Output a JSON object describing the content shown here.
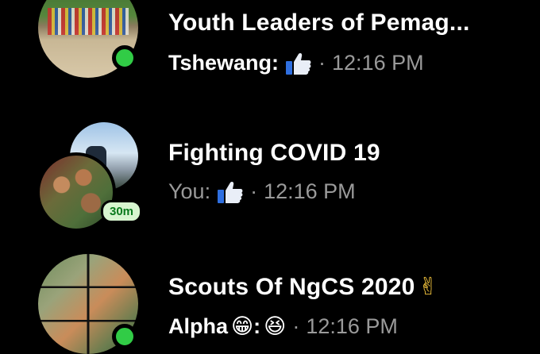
{
  "conversations": [
    {
      "title": "Youth Leaders of Pemag...",
      "sender": "Tshewang:",
      "message_icon": "thumbs-up-icon",
      "separator": "·",
      "time": "12:16 PM",
      "online": true,
      "unread": true
    },
    {
      "title": "Fighting COVID 19",
      "sender": "You:",
      "message_icon": "thumbs-up-icon",
      "separator": "·",
      "time": "12:16 PM",
      "active_badge": "30m",
      "unread": false
    },
    {
      "title": "Scouts Of NgCS 2020",
      "title_emoji": "✌",
      "sender": "Alpha",
      "message_emojis": [
        "😁",
        ":",
        "😆"
      ],
      "separator": "·",
      "time": "12:16 PM",
      "online": true,
      "unread": true
    }
  ],
  "colors": {
    "background": "#000000",
    "online_dot": "#31cc46",
    "thumb_blue": "#2f6fe0",
    "muted_text": "#9a9a9a",
    "badge_bg": "#d7f5cf",
    "badge_text": "#0a7a1d"
  }
}
